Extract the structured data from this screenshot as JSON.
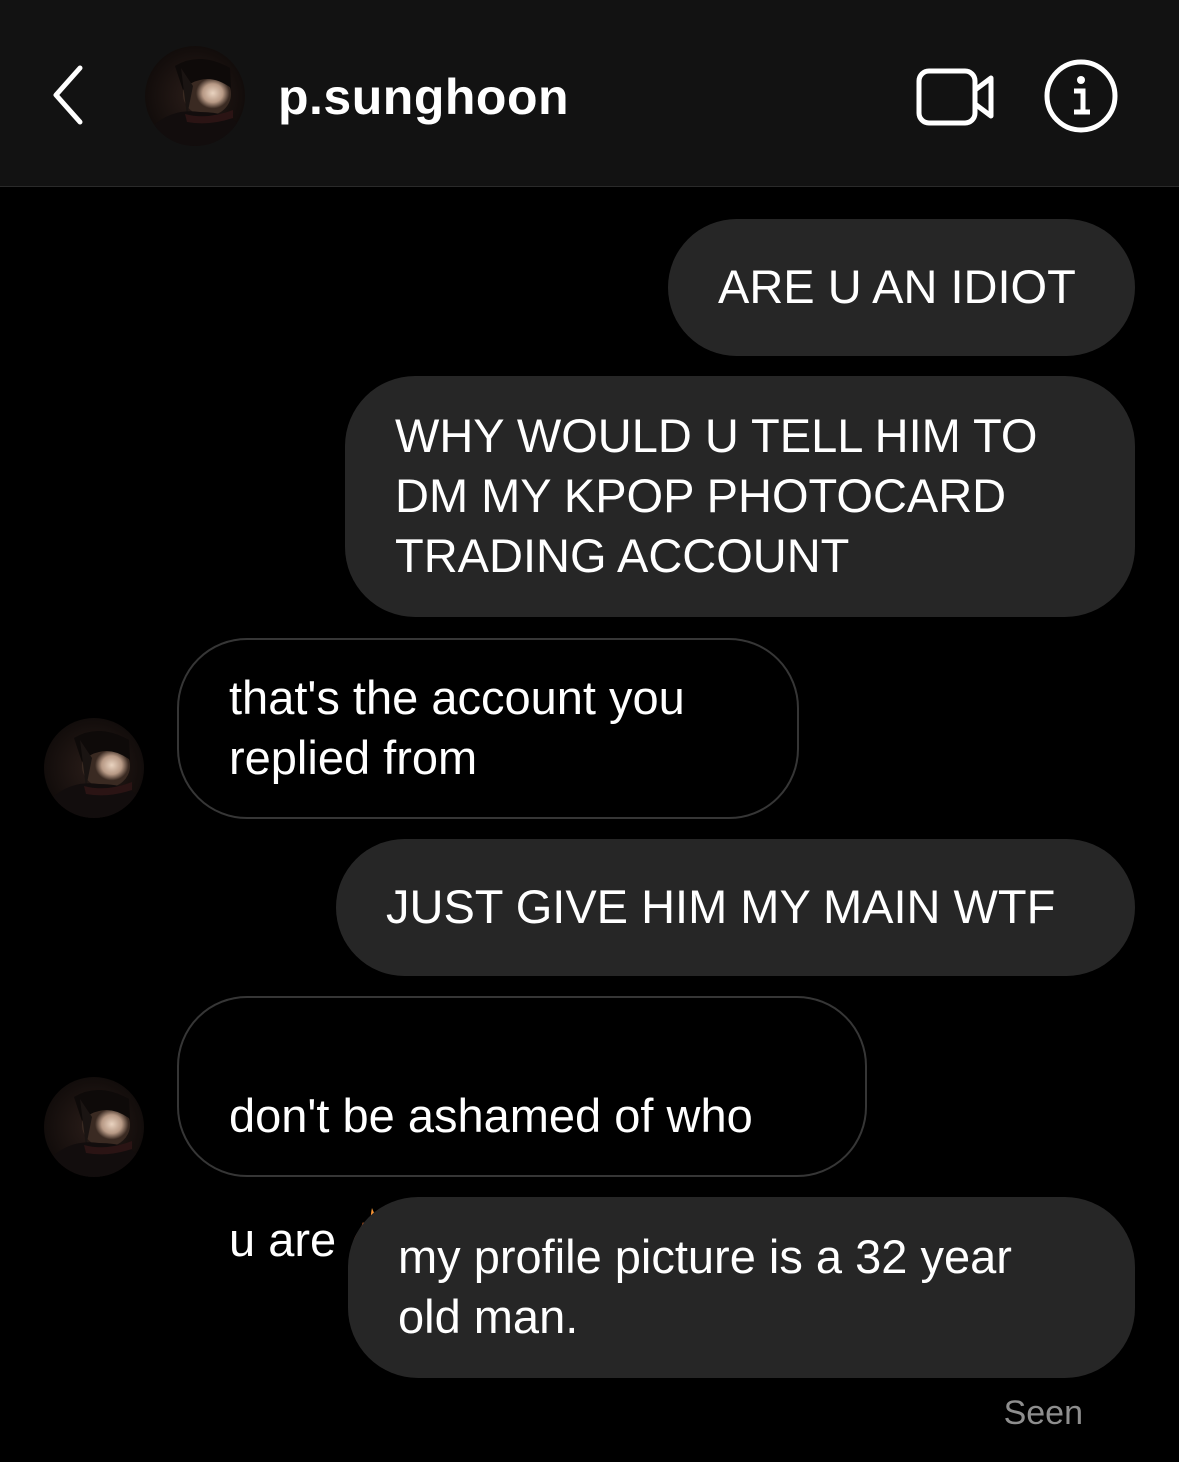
{
  "header": {
    "username": "p.sunghoon",
    "back_icon": "chevron-left-icon",
    "video_icon": "video-call-icon",
    "info_icon": "info-icon"
  },
  "messages": [
    {
      "direction": "outgoing",
      "text": "ARE U AN IDIOT"
    },
    {
      "direction": "outgoing",
      "text": "WHY WOULD U TELL HIM TO\nDM MY KPOP PHOTOCARD\nTRADING ACCOUNT"
    },
    {
      "direction": "incoming",
      "text": "that's the account you\nreplied from"
    },
    {
      "direction": "outgoing",
      "text": "JUST GIVE HIM MY MAIN WTF"
    },
    {
      "direction": "incoming",
      "text": "don't be ashamed of who\nu are",
      "emoji": "fire-emoji"
    },
    {
      "direction": "outgoing",
      "text": "my profile picture is a 32 year\nold man."
    }
  ],
  "status": {
    "seen_label": "Seen"
  },
  "colors": {
    "header_bg": "#121212",
    "outgoing_bubble": "#262626",
    "incoming_border": "#363636",
    "muted_text": "#8e8e8e"
  }
}
